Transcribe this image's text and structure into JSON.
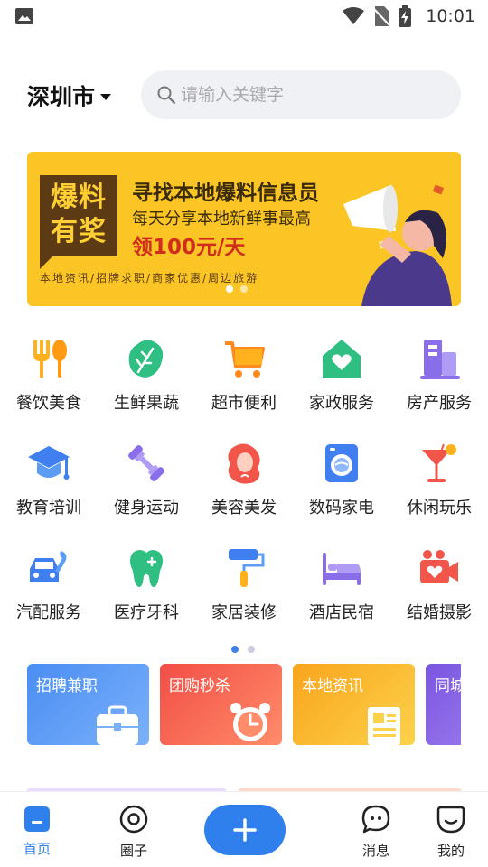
{
  "status_bar": {
    "time": "10:01"
  },
  "header": {
    "city": "深圳市",
    "search_placeholder": "请输入关键字"
  },
  "banner": {
    "badge": "爆料有奖",
    "title": "寻找本地爆料信息员",
    "subtitle": "每天分享本地新鲜事最高",
    "reward": "领100元/天",
    "tags": "本地资讯/招牌求职/商家优惠/周边旅游"
  },
  "categories": [
    {
      "label": "餐饮美食",
      "icon": "fork-spoon-icon"
    },
    {
      "label": "生鲜果蔬",
      "icon": "vegetable-icon"
    },
    {
      "label": "超市便利",
      "icon": "shopping-cart-icon"
    },
    {
      "label": "家政服务",
      "icon": "house-heart-icon"
    },
    {
      "label": "房产服务",
      "icon": "building-icon"
    },
    {
      "label": "教育培训",
      "icon": "graduation-cap-icon"
    },
    {
      "label": "健身运动",
      "icon": "dumbbell-icon"
    },
    {
      "label": "美容美发",
      "icon": "woman-hair-icon"
    },
    {
      "label": "数码家电",
      "icon": "washing-machine-icon"
    },
    {
      "label": "休闲玩乐",
      "icon": "cocktail-icon"
    },
    {
      "label": "汽配服务",
      "icon": "car-wrench-icon"
    },
    {
      "label": "医疗牙科",
      "icon": "tooth-icon"
    },
    {
      "label": "家居装修",
      "icon": "paint-roller-icon"
    },
    {
      "label": "酒店民宿",
      "icon": "bed-icon"
    },
    {
      "label": "结婚摄影",
      "icon": "camera-heart-icon"
    }
  ],
  "feature_cards": [
    {
      "label": "招聘兼职",
      "icon": "briefcase-icon",
      "color": "#5b9cf5"
    },
    {
      "label": "团购秒杀",
      "icon": "alarm-clock-icon",
      "color": "#f46a5a"
    },
    {
      "label": "本地资讯",
      "icon": "newspaper-icon",
      "color": "#f7b62a"
    },
    {
      "label": "同城",
      "icon": "",
      "color": "#8a63e6"
    }
  ],
  "tabbar": {
    "home": "首页",
    "circle": "圈子",
    "messages": "消息",
    "mine": "我的"
  },
  "colors": {
    "accent": "#2f80ed",
    "banner": "#fbc625"
  }
}
